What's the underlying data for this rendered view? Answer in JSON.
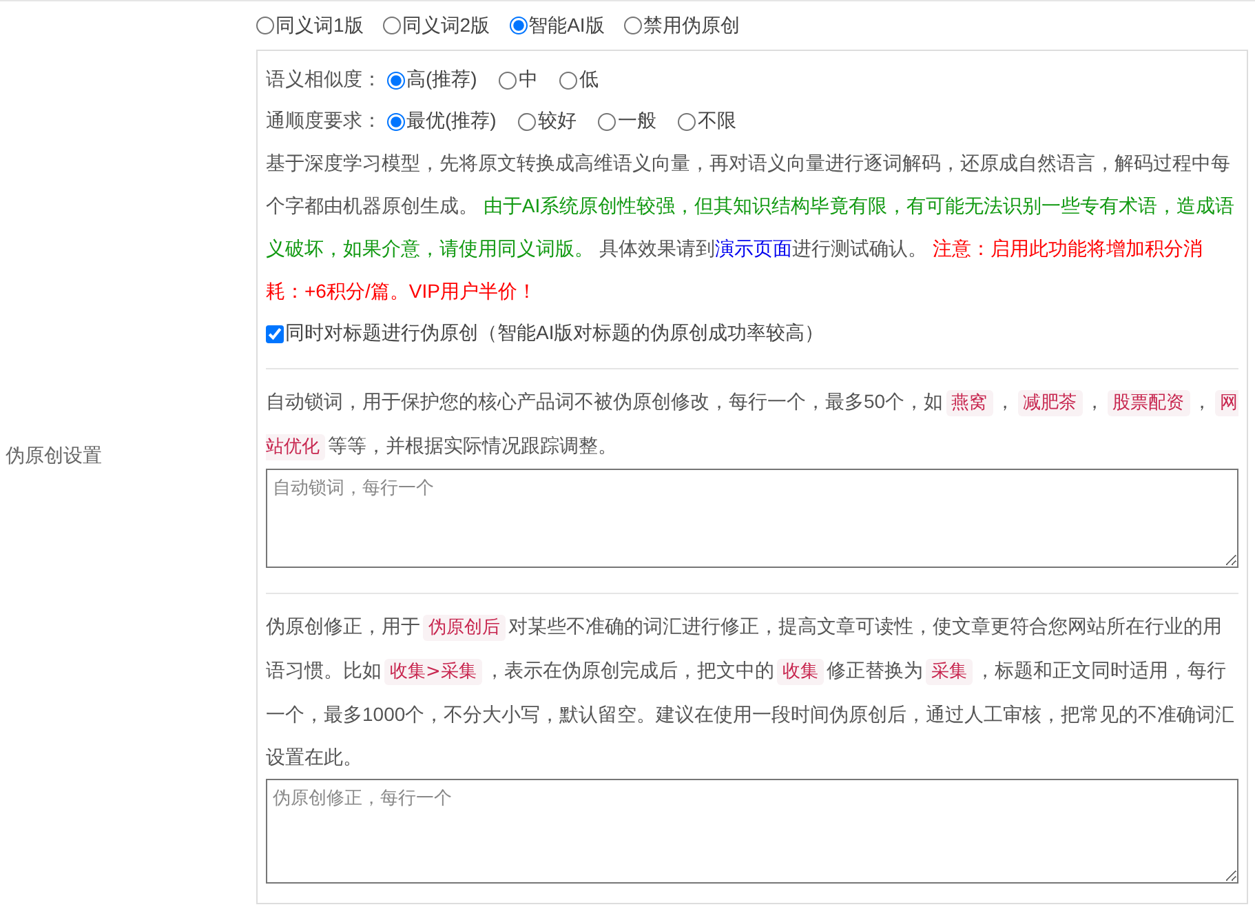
{
  "section_label": "伪原创设置",
  "modes": [
    {
      "label": "同义词1版",
      "selected": false
    },
    {
      "label": "同义词2版",
      "selected": false
    },
    {
      "label": "智能AI版",
      "selected": true
    },
    {
      "label": "禁用伪原创",
      "selected": false
    }
  ],
  "settings": [
    {
      "label": "语义相似度：",
      "options": [
        {
          "label": "高(推荐)",
          "selected": true
        },
        {
          "label": "中",
          "selected": false
        },
        {
          "label": "低",
          "selected": false
        }
      ]
    },
    {
      "label": "通顺度要求：",
      "options": [
        {
          "label": "最优(推荐)",
          "selected": true
        },
        {
          "label": "较好",
          "selected": false
        },
        {
          "label": "一般",
          "selected": false
        },
        {
          "label": "不限",
          "selected": false
        }
      ]
    }
  ],
  "ai_description": [
    {
      "kind": "plain",
      "text": "基于深度学习模型，先将原文转换成高维语义向量，再对语义向量进行逐词解码，还原成自然语言，解码过程中每个字都由机器原创生成。 "
    },
    {
      "kind": "green",
      "text": "由于AI系统原创性较强，但其知识结构毕竟有限，有可能无法识别一些专有术语，造成语义破坏，如果介意，请使用同义词版。"
    },
    {
      "kind": "plain",
      "text": " 具体效果请到"
    },
    {
      "kind": "link",
      "text": "演示页面"
    },
    {
      "kind": "plain",
      "text": "进行测试确认。 "
    },
    {
      "kind": "red",
      "text": "注意：启用此功能将增加积分消耗：+6积分/篇。VIP用户半价！"
    }
  ],
  "title_option": {
    "label": "同时对标题进行伪原创（智能AI版对标题的伪原创成功率较高）",
    "checked": true
  },
  "lock_words": {
    "description": [
      {
        "kind": "plain",
        "text": "自动锁词，用于保护您的核心产品词不被伪原创修改，每行一个，最多50个，如"
      },
      {
        "kind": "tag",
        "text": "燕窝"
      },
      {
        "kind": "plain",
        "text": "，"
      },
      {
        "kind": "tag",
        "text": "减肥茶"
      },
      {
        "kind": "plain",
        "text": "，"
      },
      {
        "kind": "tag",
        "text": "股票配资"
      },
      {
        "kind": "plain",
        "text": "，"
      },
      {
        "kind": "tag",
        "text": "网站优化"
      },
      {
        "kind": "plain",
        "text": "等等，并根据实际情况跟踪调整。"
      }
    ],
    "placeholder": "自动锁词，每行一个"
  },
  "correction": {
    "description": [
      {
        "kind": "plain",
        "text": "伪原创修正，用于"
      },
      {
        "kind": "tag",
        "text": "伪原创后"
      },
      {
        "kind": "plain",
        "text": "对某些不准确的词汇进行修正，提高文章可读性，使文章更符合您网站所在行业的用语习惯。比如"
      },
      {
        "kind": "tag",
        "text": "收集>采集"
      },
      {
        "kind": "plain",
        "text": "，表示在伪原创完成后，把文中的"
      },
      {
        "kind": "tag",
        "text": "收集"
      },
      {
        "kind": "plain",
        "text": "修正替换为"
      },
      {
        "kind": "tag",
        "text": "采集"
      },
      {
        "kind": "plain",
        "text": "，标题和正文同时适用，每行一个，最多1000个，不分大小写，默认留空。建议在使用一段时间伪原创后，通过人工审核，把常见的不准确词汇设置在此。"
      }
    ],
    "placeholder": "伪原创修正，每行一个"
  }
}
